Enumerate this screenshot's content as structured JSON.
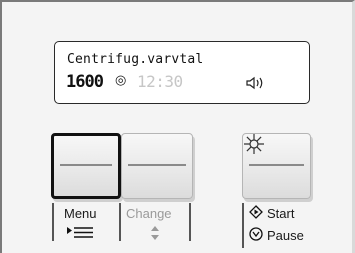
{
  "display": {
    "program_text": "Centrifug.varvtal",
    "spin_speed": "1600",
    "time": "12:30",
    "icons": [
      "target-rpm-icon",
      "sound-icon"
    ]
  },
  "buttons": {
    "menu_label": "Menu",
    "change_label": "Change",
    "start_label": "Start",
    "pause_label": "Pause"
  },
  "colors": {
    "panel_bg": "#f4f4f4",
    "text_dark": "#1a1a1a",
    "text_disabled": "#9a9a9a",
    "time_dim": "#c6c6c6"
  }
}
